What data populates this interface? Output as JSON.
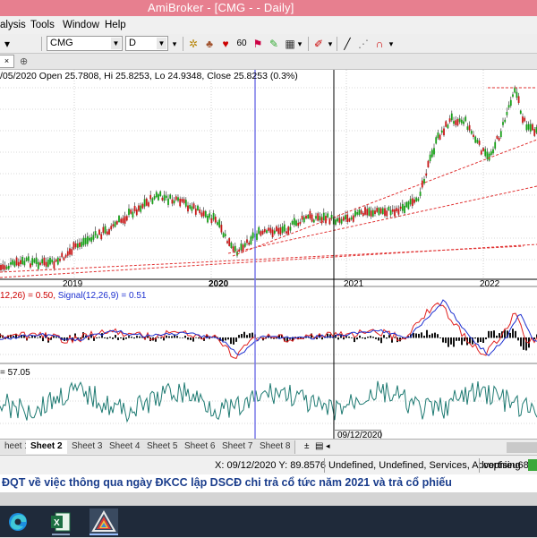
{
  "window": {
    "title": "AmiBroker - [CMG -  - Daily]"
  },
  "menu": [
    "alysis",
    "Tools",
    "Window",
    "Help"
  ],
  "toolbar": {
    "symbol": "CMG",
    "interval": "D"
  },
  "chart": {
    "info_line": "/05/2020 Open 25.7808, Hi 25.8253, Lo 24.9348, Close 25.8253 (0.3%)",
    "x_ticks": [
      "2019",
      "2020",
      "2021",
      "2022"
    ],
    "macd_label_prefix": "12,26) = 0.50, ",
    "macd_label_signal": "Signal(12,26,9) = 0.51",
    "rsi_label": "= 57.05",
    "crosshair_date": "09/12/2020"
  },
  "sheets": [
    "heet 1",
    "Sheet 2",
    "Sheet 3",
    "Sheet 4",
    "Sheet 5",
    "Sheet 6",
    "Sheet 7",
    "Sheet 8"
  ],
  "active_sheet": "Sheet 2",
  "status": {
    "coords": "X: 09/12/2020   Y: 89.8576",
    "categories": "Undefined, Undefined, Services, Advertising",
    "user": "cophieu68"
  },
  "ticker": "ĐQT về việc thông qua ngày ĐKCC lập DSCĐ chi trả cổ tức năm 2021 và trả cổ phiếu",
  "taskbar": {
    "icons": [
      "edge-icon",
      "excel-icon",
      "amibroker-icon"
    ]
  }
}
